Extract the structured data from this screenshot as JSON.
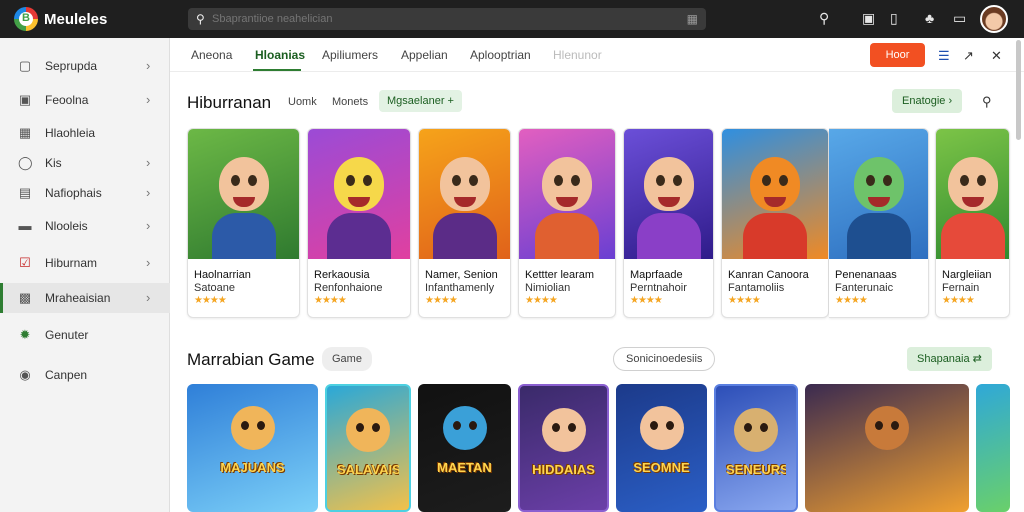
{
  "app": {
    "title": "Meuleles",
    "logo_letter": "B"
  },
  "search": {
    "placeholder": "Sbaprantiioe neahelician",
    "value": ""
  },
  "topbar_icons": [
    "search-icon",
    "tablet-icon",
    "bookmark-icon",
    "puzzle-icon",
    "phone-icon"
  ],
  "sidebar": {
    "items": [
      {
        "label": "Seprupda",
        "icon": "square-icon",
        "chevron": true
      },
      {
        "label": "Feoolna",
        "icon": "window-icon",
        "chevron": true
      },
      {
        "label": "Hlaohleia",
        "icon": "grid-icon",
        "chevron": false
      },
      {
        "label": "Kis",
        "icon": "location-icon",
        "chevron": true
      },
      {
        "label": "Nafiophais",
        "icon": "folder-icon",
        "chevron": true
      },
      {
        "label": "Nlooleis",
        "icon": "list-icon",
        "chevron": true
      },
      {
        "label": "Hiburnam",
        "icon": "checkbox-icon",
        "chevron": true
      },
      {
        "label": "Mraheaisian",
        "icon": "box-icon",
        "chevron": true,
        "active": true
      },
      {
        "label": "Genuter",
        "icon": "tag-icon",
        "chevron": false
      },
      {
        "label": "Canpen",
        "icon": "gamepad-icon",
        "chevron": false
      }
    ]
  },
  "tabs": [
    {
      "label": "Aneona"
    },
    {
      "label": "Hloanias",
      "active": true
    },
    {
      "label": "Apiliumers"
    },
    {
      "label": "Appelian"
    },
    {
      "label": "Aplooptrian"
    },
    {
      "label": "Hlenunor",
      "disabled": true
    }
  ],
  "header_actions": {
    "red_button": "Hoor"
  },
  "section1": {
    "title": "Hiburranan",
    "chips": [
      "Uomk",
      "Monets"
    ],
    "green_chip": "Mgsaelaner",
    "more_button": "Enatogie",
    "cards": [
      {
        "title": "Haolnarrian",
        "subtitle": "Satoane",
        "rating": "★★★★",
        "colors": [
          "#6cb846",
          "#2f7a2f",
          "#2c5aa8"
        ]
      },
      {
        "title": "Rerkaousia",
        "subtitle": "Renfonhaione",
        "rating": "★★★★",
        "colors": [
          "#9b4bd6",
          "#e040a0",
          "#5c2d91"
        ]
      },
      {
        "title": "Namer, Senion",
        "subtitle": "Infanthamenly",
        "rating": "★★★★",
        "colors": [
          "#f6a31a",
          "#e0621a",
          "#5b2c87"
        ]
      },
      {
        "title": "Kettter learam",
        "subtitle": "Nimiolian",
        "rating": "★★★★",
        "colors": [
          "#e25fc0",
          "#6a3fd2",
          "#e06030"
        ]
      },
      {
        "title": "Maprfaade",
        "subtitle": "Perntnahoir",
        "rating": "★★★★",
        "colors": [
          "#6b4fd8",
          "#2f1b8a",
          "#8a3fc7"
        ]
      },
      {
        "title": "Kanran  Canoora",
        "subtitle": "Fantamoliis",
        "rating": "★★★★",
        "colors": [
          "#2f8fe0",
          "#f08a24",
          "#d83a2a"
        ]
      },
      {
        "title": "Penenanaas",
        "subtitle": "Fanterunaic",
        "rating": "★★★★",
        "colors": [
          "#58a8e8",
          "#2e6fc0",
          "#1e4f90"
        ]
      },
      {
        "title": "Nargleiian",
        "subtitle": "Fernain",
        "rating": "★★★★",
        "colors": [
          "#7cc447",
          "#2f8a2f",
          "#e64a3a"
        ]
      }
    ]
  },
  "section2": {
    "title": "Marrabian Game",
    "chip": "Game",
    "outline_chip": "Sonicinoedesiis",
    "more_button": "Shapanaia",
    "cards": [
      {
        "banner": "MAJUANS",
        "colors": [
          "#2f7fd8",
          "#7cd0f8"
        ]
      },
      {
        "banner": "SALAVAIS",
        "colors": [
          "#2aa8d8",
          "#f2c14a"
        ]
      },
      {
        "banner": "MAETAN",
        "colors": [
          "#111111",
          "#1d1d1d"
        ]
      },
      {
        "banner": "HIDDAIAS",
        "colors": [
          "#3a2a6a",
          "#6b3fa8"
        ]
      },
      {
        "banner": "SEOMNE",
        "colors": [
          "#1c3a8a",
          "#2b5fc6"
        ]
      },
      {
        "banner": "SENEURS",
        "colors": [
          "#2d4fb8",
          "#8aa8f0"
        ]
      },
      {
        "banner": "",
        "colors": [
          "#3a2a50",
          "#f0a030"
        ]
      },
      {
        "banner": "",
        "colors": [
          "#2fa8d8",
          "#6ad06a"
        ]
      }
    ]
  }
}
